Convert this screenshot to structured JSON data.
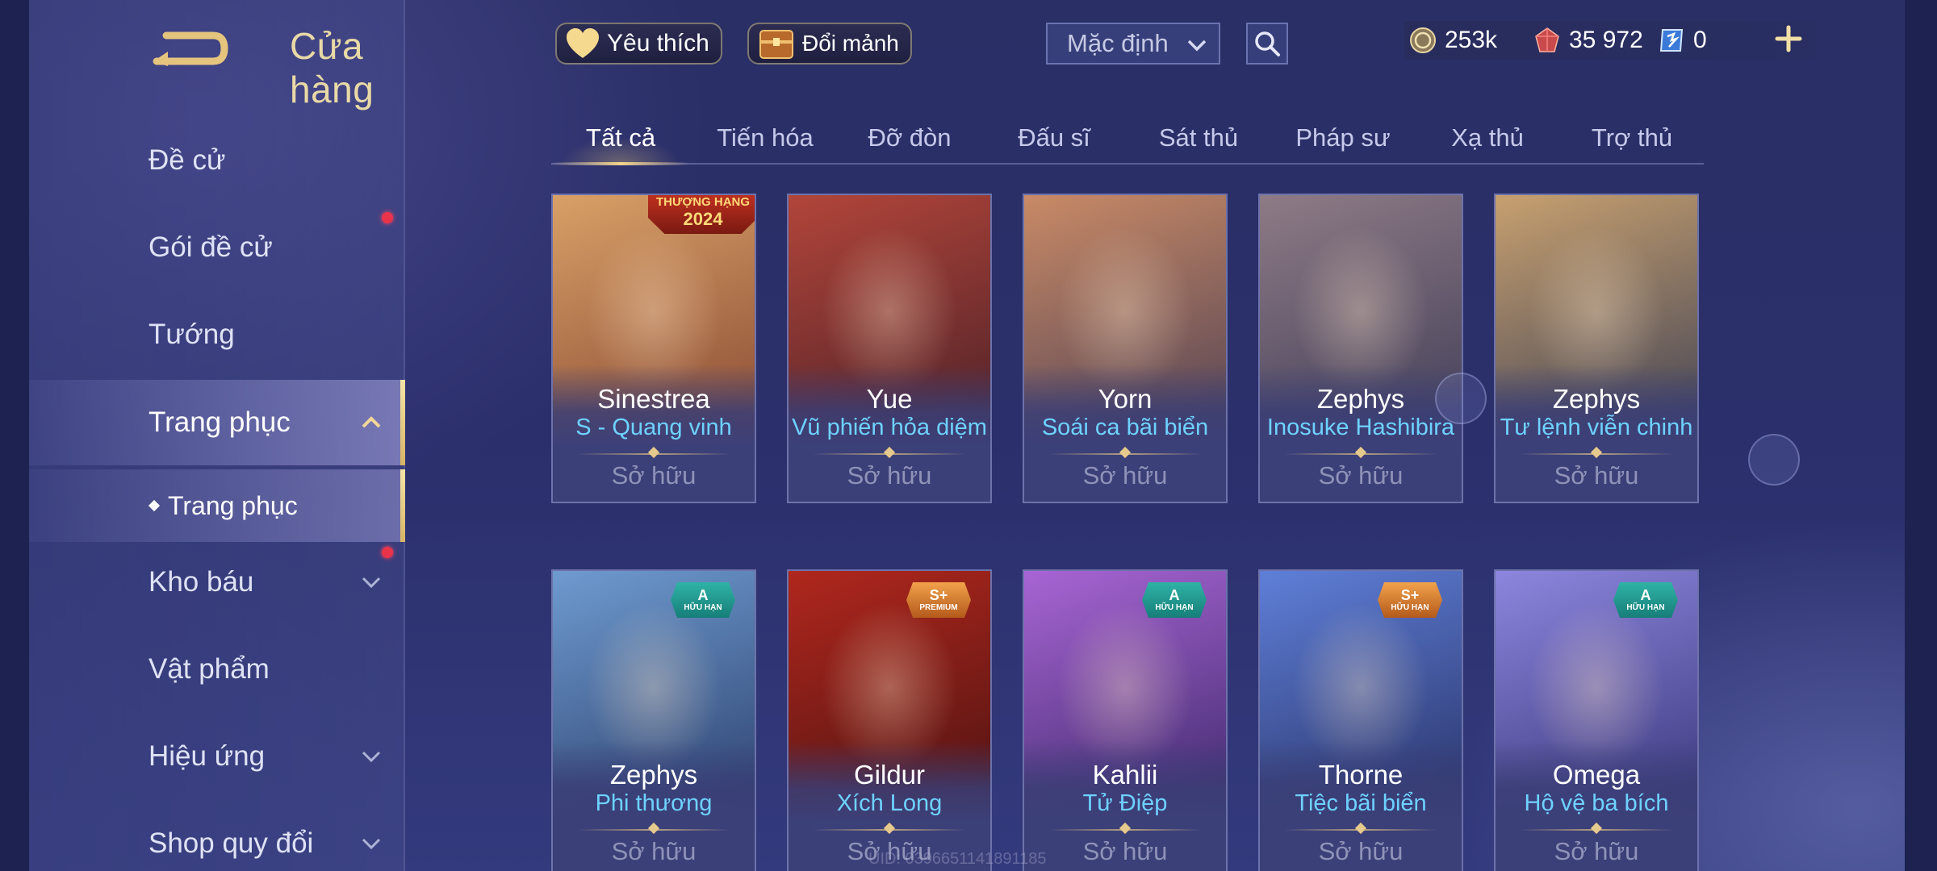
{
  "header": {
    "title": "Cửa hàng",
    "favorite_label": "Yêu thích",
    "exchange_label": "Đổi mảnh",
    "sort_value": "Mặc định"
  },
  "currency": {
    "gold": "253k",
    "ruby": "35 972",
    "voucher": "0"
  },
  "sidebar": {
    "items": [
      {
        "label": "Đề cử"
      },
      {
        "label": "Gói đề cử"
      },
      {
        "label": "Tướng"
      },
      {
        "label": "Trang phục"
      },
      {
        "label": "Kho báu"
      },
      {
        "label": "Vật phẩm"
      },
      {
        "label": "Hiệu ứng"
      },
      {
        "label": "Shop quy đổi"
      }
    ],
    "sub_item": "Trang phục"
  },
  "tabs": [
    "Tất cả",
    "Tiến hóa",
    "Đỡ đòn",
    "Đấu sĩ",
    "Sát thủ",
    "Pháp sư",
    "Xạ thủ",
    "Trợ thủ"
  ],
  "cards": [
    {
      "hero": "Sinestrea",
      "skin": "S - Quang vinh",
      "status": "Sở hữu",
      "banner_top": "THƯỢNG HẠNG",
      "banner_year": "2024",
      "colors": [
        "#d9a067",
        "#7a3a2a"
      ]
    },
    {
      "hero": "Yue",
      "skin": "Vũ phiến hỏa diệm",
      "status": "Sở hữu",
      "colors": [
        "#b2453a",
        "#3a1a24"
      ]
    },
    {
      "hero": "Yorn",
      "skin": "Soái ca bãi biển",
      "status": "Sở hữu",
      "colors": [
        "#c98a66",
        "#3b3450"
      ]
    },
    {
      "hero": "Zephys",
      "skin": "Inosuke Hashibira",
      "status": "Sở hữu",
      "colors": [
        "#8e7b86",
        "#33324f"
      ]
    },
    {
      "hero": "Zephys",
      "skin": "Tư lệnh viễn chinh",
      "status": "Sở hữu",
      "colors": [
        "#c7a06f",
        "#27304f"
      ]
    },
    {
      "hero": "Zephys",
      "skin": "Phi thương",
      "status": "Sở hữu",
      "badge": {
        "grade": "A",
        "sub": "HỮU HẠN",
        "tone": "teal"
      },
      "colors": [
        "#6f9bd0",
        "#1f2f5b"
      ]
    },
    {
      "hero": "Gildur",
      "skin": "Xích Long",
      "status": "Sở hữu",
      "badge": {
        "grade": "S+",
        "sub": "PREMIUM",
        "tone": "orange"
      },
      "colors": [
        "#b0271d",
        "#3b0f10"
      ]
    },
    {
      "hero": "Kahlii",
      "skin": "Tử Điệp",
      "status": "Sở hữu",
      "badge": {
        "grade": "A",
        "sub": "HỮU HẠN",
        "tone": "teal"
      },
      "colors": [
        "#a865d4",
        "#2a1e58"
      ]
    },
    {
      "hero": "Thorne",
      "skin": "Tiệc bãi biển",
      "status": "Sở hữu",
      "badge": {
        "grade": "S+",
        "sub": "HỮU HẠN",
        "tone": "orange"
      },
      "colors": [
        "#5f7fd8",
        "#1e2452"
      ]
    },
    {
      "hero": "Omega",
      "skin": "Hộ vệ ba bích",
      "status": "Sở hữu",
      "badge": {
        "grade": "A",
        "sub": "HỮU HẠN",
        "tone": "teal"
      },
      "colors": [
        "#8d86de",
        "#2a2868"
      ]
    }
  ],
  "uid": "UID: 0396651141891185"
}
